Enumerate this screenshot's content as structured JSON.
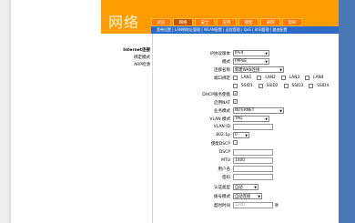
{
  "header": {
    "brand": "网络"
  },
  "tabs": [
    "状态",
    "网络",
    "安全",
    "应用",
    "管理",
    "录制",
    "帮助"
  ],
  "subnav": "宽带设置 | LAN侧地址管理 | WLAN配置 | 远程管理 | QoS | 时间管理 | 路由配置",
  "sidebar": {
    "items": [
      "Internet连接",
      "绑定模式",
      "ARP检测"
    ]
  },
  "form": {
    "ip_version": {
      "label": "IP协议版本",
      "value": "IPv4"
    },
    "mode": {
      "label": "模式",
      "value": "PPPoE"
    },
    "conn_name": {
      "label": "连接名称",
      "value": "新建WAN连接"
    },
    "port_bind": {
      "label": "端口绑定",
      "row1": [
        "LAN1",
        "LAN2",
        "LAN3",
        "LAN4"
      ],
      "row2": [
        "SSID1",
        "SSID2",
        "SSID3",
        "SSID4"
      ]
    },
    "dhcp": {
      "label": "DHCP服务使能"
    },
    "nat": {
      "label": "启用NAT"
    },
    "service": {
      "label": "业务模式",
      "value": "INTERNET"
    },
    "vlan_mode": {
      "label": "VLAN 模式",
      "value": "TAG"
    },
    "vlan_id": {
      "label": "VLAN ID",
      "value": ""
    },
    "dot1p": {
      "label": "802.1p",
      "value": "0"
    },
    "dscp_enable": {
      "label": "使能DSCP"
    },
    "dscp": {
      "label": "DSCP",
      "value": ""
    },
    "mtu": {
      "label": "MTU",
      "value": "1400"
    },
    "username": {
      "label": "用户名",
      "value": ""
    },
    "password": {
      "label": "密码",
      "value": ""
    },
    "auth": {
      "label": "认证类型",
      "value": "自动"
    },
    "dial": {
      "label": "拨号模式",
      "value": "自动连接"
    },
    "idle": {
      "label": "超时时间",
      "value": "1200",
      "unit": "秒"
    }
  }
}
